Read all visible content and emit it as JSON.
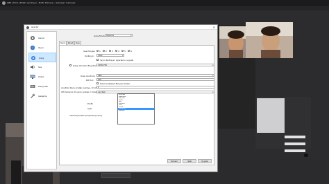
{
  "obs": {
    "title": "OBS 18.0.1 (64bit, windows) - Profil: Ezmo(s) - Sahneler: Sahneler"
  },
  "dialog": {
    "title": "Ayarlar",
    "close_glyph": "✕",
    "sidebar": [
      {
        "label": "Genel",
        "icon": "gear-icon"
      },
      {
        "label": "Yayın",
        "icon": "globe-icon"
      },
      {
        "label": "Çıkış",
        "icon": "output-icon"
      },
      {
        "label": "Ses",
        "icon": "speaker-icon"
      },
      {
        "label": "Video",
        "icon": "monitor-icon"
      },
      {
        "label": "Kısayollar",
        "icon": "keyboard-icon"
      },
      {
        "label": "Gelişmiş",
        "icon": "wrench-icon"
      }
    ],
    "output_mode_label": "Çıkış Modu",
    "output_mode_value": "Gelişmiş",
    "tabs": [
      "Yayın",
      "Kayıt",
      "Ses"
    ],
    "audio_track_label": "Ses Parçası",
    "audio_tracks": [
      "1",
      "2",
      "3",
      "4",
      "5",
      "6"
    ],
    "encoder_label": "Kodlayıcı",
    "encoder_value": "x264",
    "rescale_check_label": "Yayın Kodlayıcı Ayarlarını uygula",
    "rescale_label": "Çıkışı Yeniden Boyutlandır",
    "rescale_value": "1280x720",
    "rate_control_label": "Oran Kontrolü",
    "rate_control_value": "CBR",
    "bitrate_label": "Bit Hızı",
    "bitrate_value": "900",
    "custom_buffer_label": "Özel Arabellek Boyutu Kullan",
    "keyframe_label": "Anahtar Kare Aralığı (saniye, 0=otomatik)",
    "keyframe_value": "0",
    "cpu_preset_label": "CPU Kullanımı Ön Ayarı (yüksek = daha az CPU kullanımı)",
    "cpu_preset_value": "veryfast",
    "profile_label": "Profil",
    "tune_label": "Ayar",
    "x264_options_label": "x264 Seçenekleri (boşlukla ayrılmış)",
    "preset_options": [
      "ultrafast",
      "superfast",
      "veryfast",
      "faster",
      "fast",
      "medium",
      "slow",
      "slower",
      "veryslow",
      "placebo"
    ],
    "preset_highlighted": "veryslow",
    "buttons": {
      "ok": "Tamam",
      "cancel": "İptal",
      "apply": "Uygula"
    }
  }
}
